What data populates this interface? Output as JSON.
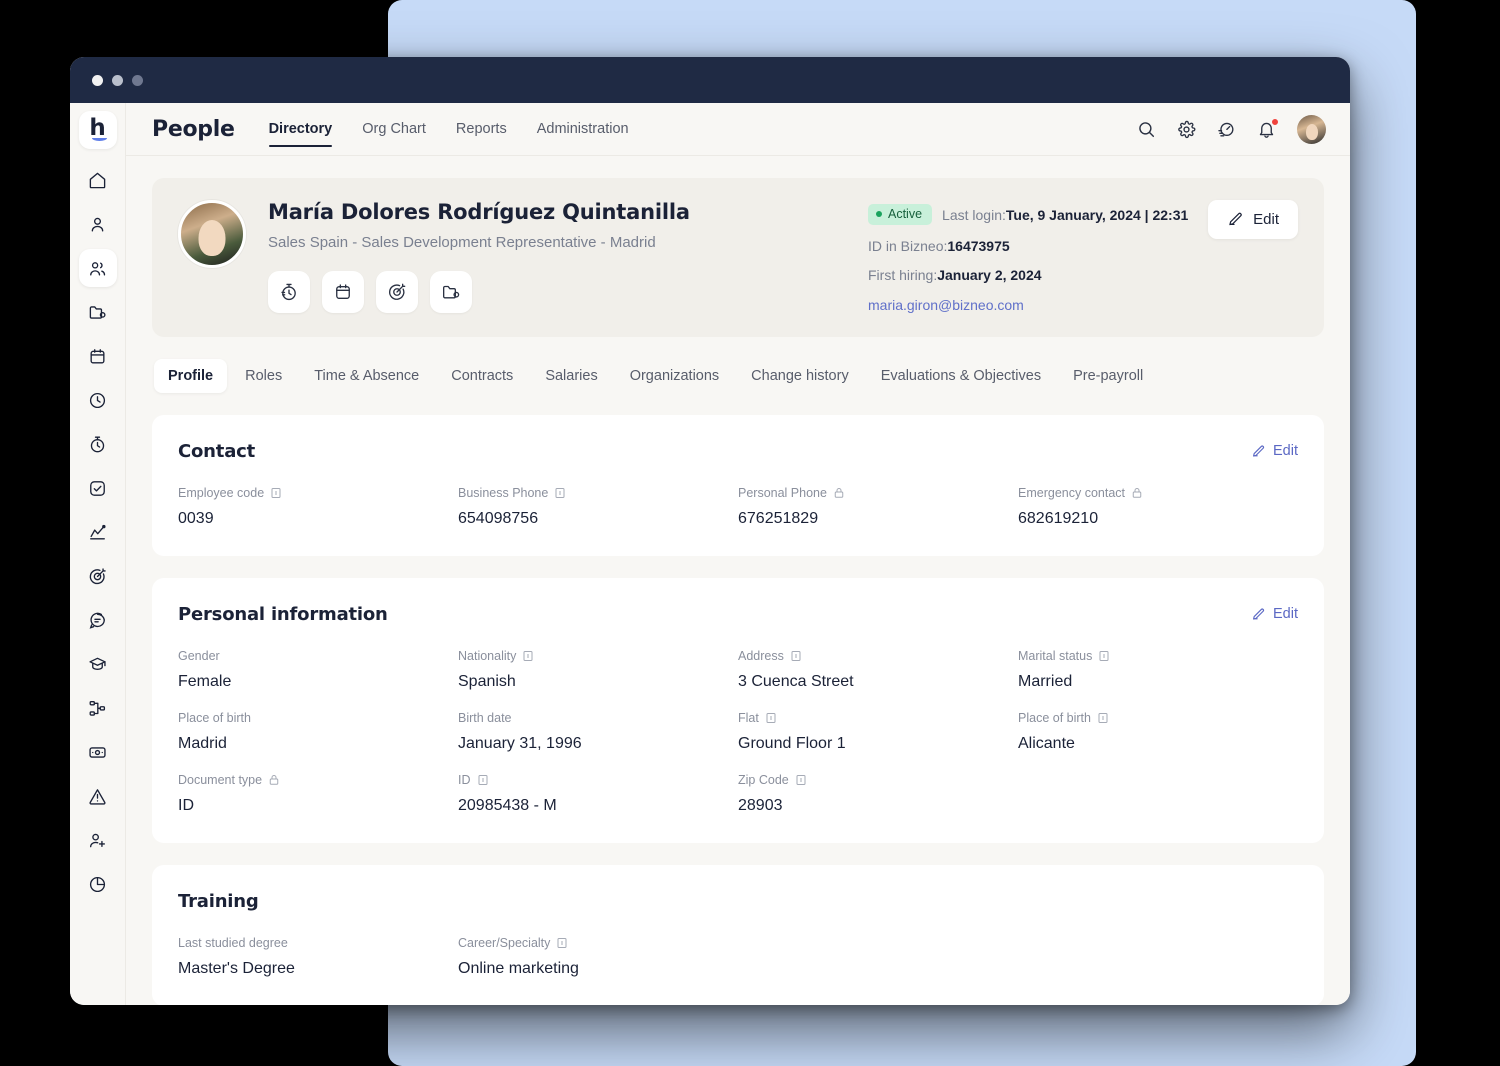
{
  "window": {
    "dots": [
      "close",
      "minimize",
      "maximize"
    ]
  },
  "sidebar": {
    "logo": "h",
    "items": [
      {
        "name": "home",
        "icon": "home-icon",
        "active": false
      },
      {
        "name": "profile",
        "icon": "user-icon",
        "active": false
      },
      {
        "name": "people",
        "icon": "people-icon",
        "active": true
      },
      {
        "name": "documents",
        "icon": "folder-icon",
        "active": false
      },
      {
        "name": "calendar",
        "icon": "calendar-icon",
        "active": false
      },
      {
        "name": "time",
        "icon": "clock-icon",
        "active": false
      },
      {
        "name": "timesheet",
        "icon": "stopwatch-icon",
        "active": false
      },
      {
        "name": "tasks",
        "icon": "check-square-icon",
        "active": false
      },
      {
        "name": "analytics",
        "icon": "chart-line-icon",
        "active": false
      },
      {
        "name": "goals",
        "icon": "target-icon",
        "active": false
      },
      {
        "name": "feedback",
        "icon": "chat-icon",
        "active": false
      },
      {
        "name": "training",
        "icon": "graduation-cap-icon",
        "active": false
      },
      {
        "name": "workflow",
        "icon": "workflow-icon",
        "active": false
      },
      {
        "name": "payroll",
        "icon": "money-icon",
        "active": false
      },
      {
        "name": "alerts",
        "icon": "warning-icon",
        "active": false
      },
      {
        "name": "recruitment",
        "icon": "add-user-icon",
        "active": false
      },
      {
        "name": "reports",
        "icon": "pie-chart-icon",
        "active": false
      }
    ]
  },
  "topbar": {
    "brand": "People",
    "tabs": [
      {
        "label": "Directory",
        "selected": true
      },
      {
        "label": "Org Chart",
        "selected": false
      },
      {
        "label": "Reports",
        "selected": false
      },
      {
        "label": "Administration",
        "selected": false
      }
    ],
    "icons": [
      {
        "name": "search-icon"
      },
      {
        "name": "gear-icon"
      },
      {
        "name": "speedometer-icon"
      },
      {
        "name": "bell-icon",
        "has_notification": true
      }
    ]
  },
  "profile": {
    "name": "María Dolores Rodríguez Quintanilla",
    "subtitle": "Sales Spain - Sales Development Representative - Madrid",
    "quick_actions": [
      "stopwatch-icon",
      "calendar-icon",
      "target-icon",
      "folder-icon"
    ],
    "status": "Active",
    "last_login_label": "Last login:",
    "last_login_value": "Tue, 9 January, 2024 | 22:31",
    "id_label": "ID in Bizneo:",
    "id_value": "16473975",
    "hiring_label": "First hiring:",
    "hiring_value": "January 2, 2024",
    "email": "maria.giron@bizneo.com",
    "edit_label": "Edit"
  },
  "section_tabs": [
    {
      "label": "Profile",
      "selected": true
    },
    {
      "label": "Roles",
      "selected": false
    },
    {
      "label": "Time & Absence",
      "selected": false
    },
    {
      "label": "Contracts",
      "selected": false
    },
    {
      "label": "Salaries",
      "selected": false
    },
    {
      "label": "Organizations",
      "selected": false
    },
    {
      "label": "Change history",
      "selected": false
    },
    {
      "label": "Evaluations & Objectives",
      "selected": false
    },
    {
      "label": "Pre-payroll",
      "selected": false
    }
  ],
  "cards": [
    {
      "title": "Contact",
      "edit_label": "Edit",
      "fields": [
        {
          "label": "Employee code",
          "value": "0039",
          "icon": "card-icon"
        },
        {
          "label": "Business Phone",
          "value": "654098756",
          "icon": "card-icon"
        },
        {
          "label": "Personal Phone",
          "value": "676251829",
          "icon": "lock-icon"
        },
        {
          "label": "Emergency contact",
          "value": "682619210",
          "icon": "lock-icon"
        }
      ]
    },
    {
      "title": "Personal information",
      "edit_label": "Edit",
      "fields": [
        {
          "label": "Gender",
          "value": "Female",
          "icon": "none"
        },
        {
          "label": "Nationality",
          "value": "Spanish",
          "icon": "card-icon"
        },
        {
          "label": "Address",
          "value": "3 Cuenca Street",
          "icon": "card-icon"
        },
        {
          "label": "Marital status",
          "value": "Married",
          "icon": "card-icon"
        },
        {
          "label": "Place of birth",
          "value": "Madrid",
          "icon": "none"
        },
        {
          "label": "Birth date",
          "value": "January 31, 1996",
          "icon": "none"
        },
        {
          "label": "Flat",
          "value": "Ground Floor 1",
          "icon": "card-icon"
        },
        {
          "label": "Place of birth",
          "value": "Alicante",
          "icon": "card-icon"
        },
        {
          "label": "Document type",
          "value": "ID",
          "icon": "lock-icon"
        },
        {
          "label": "ID",
          "value": "20985438 - M",
          "icon": "card-icon"
        },
        {
          "label": "Zip Code",
          "value": "28903",
          "icon": "card-icon"
        },
        {
          "label": "",
          "value": "",
          "icon": "none"
        }
      ]
    },
    {
      "title": "Training",
      "edit_label": "",
      "fields": [
        {
          "label": "Last studied degree",
          "value": "Master's Degree",
          "icon": "none"
        },
        {
          "label": "Career/Specialty",
          "value": "Online marketing",
          "icon": "card-icon"
        },
        {
          "label": "",
          "value": "",
          "icon": "none"
        },
        {
          "label": "",
          "value": "",
          "icon": "none"
        }
      ]
    }
  ],
  "colors": {
    "backdrop": "#c6daf7",
    "titlebar": "#1f2a44",
    "app_bg": "#f8f7f4",
    "accent_link": "#5b68c4",
    "status_green_bg": "#c8f0da",
    "status_green_text": "#17603c",
    "notification_red": "#f0423c",
    "text_primary": "#1b2237",
    "text_muted": "#8a8f9c"
  }
}
